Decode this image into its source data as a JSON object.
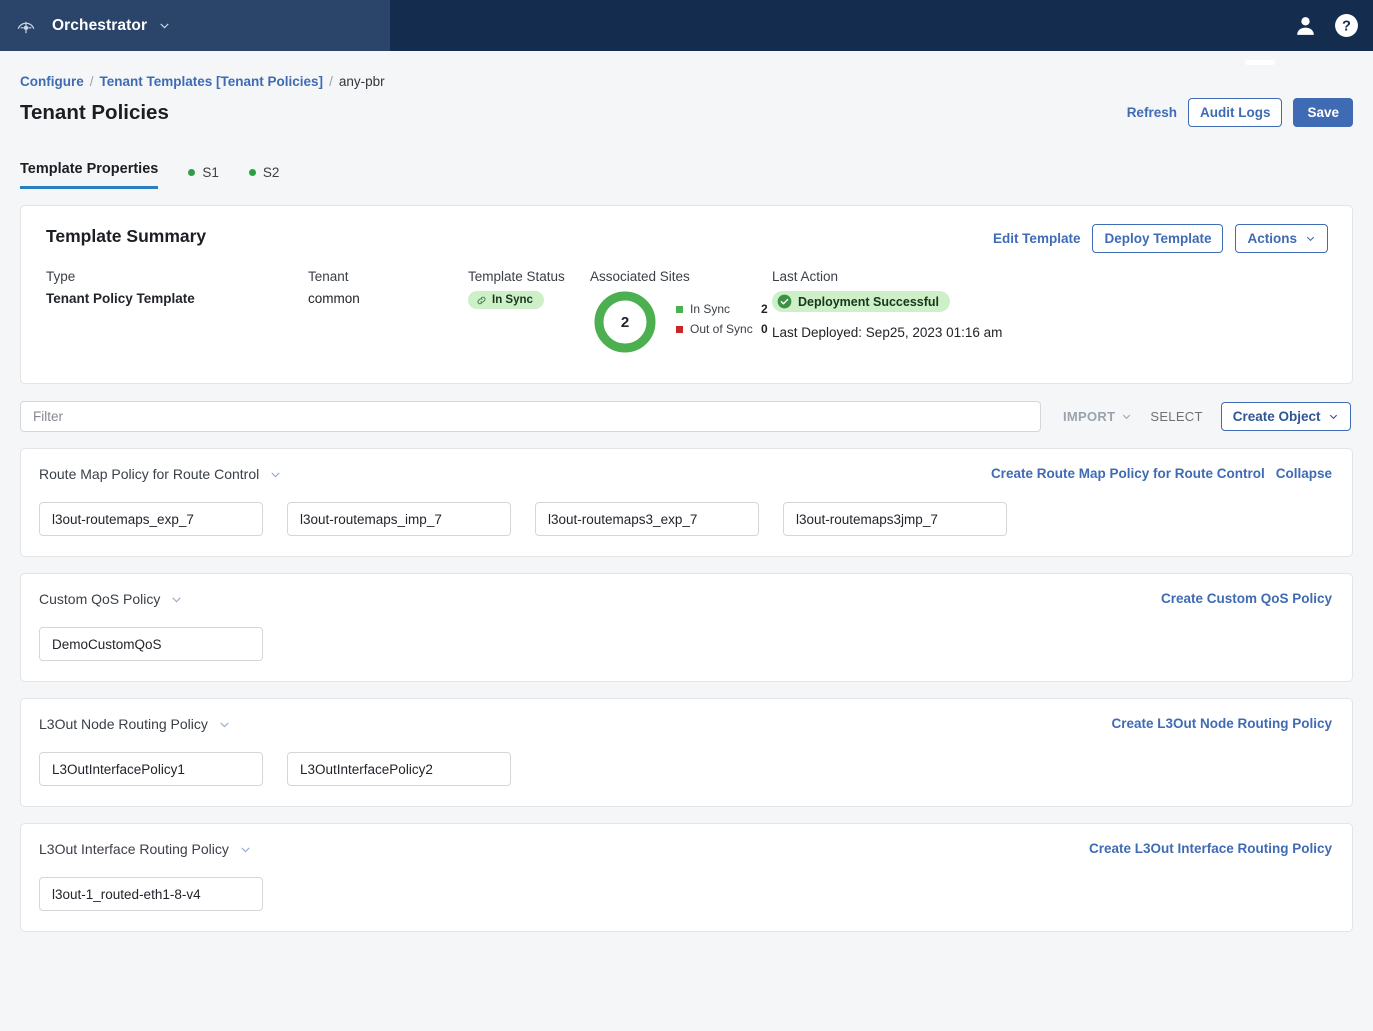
{
  "topbar": {
    "app_title": "Orchestrator",
    "logo_icon": "orchestrator-logo-icon",
    "chevron_icon": "chevron-down-icon",
    "user_icon": "user-avatar-icon",
    "help_icon": "help-circle-icon"
  },
  "breadcrumb": {
    "items": [
      {
        "label": "Configure",
        "link": true
      },
      {
        "label": "Tenant Templates [Tenant Policies]",
        "link": true
      },
      {
        "label": "any-pbr",
        "link": false
      }
    ],
    "separator": "/"
  },
  "page": {
    "title": "Tenant Policies",
    "refresh_label": "Refresh",
    "audit_logs_label": "Audit Logs",
    "save_label": "Save"
  },
  "tabs": [
    {
      "label": "Template Properties",
      "active": true,
      "dot": false
    },
    {
      "label": "S1",
      "active": false,
      "dot": true
    },
    {
      "label": "S2",
      "active": false,
      "dot": true
    }
  ],
  "summary": {
    "title": "Template Summary",
    "edit_template_label": "Edit Template",
    "deploy_template_label": "Deploy Template",
    "actions_label": "Actions",
    "type_label": "Type",
    "type_value": "Tenant Policy Template",
    "tenant_label": "Tenant",
    "tenant_value": "common",
    "status_label": "Template Status",
    "status_badge": "In Sync",
    "status_icon": "link-chain-icon",
    "sites_label": "Associated Sites",
    "sites_total": "2",
    "legend": [
      {
        "name": "In Sync",
        "value": "2",
        "color": "#4caf50"
      },
      {
        "name": "Out of Sync",
        "value": "0",
        "color": "#c62828"
      }
    ],
    "last_action_label": "Last Action",
    "last_action_badge": "Deployment Successful",
    "last_action_icon": "check-circle-icon",
    "last_deployed": "Last Deployed: Sep25, 2023 01:16 am"
  },
  "filterbar": {
    "placeholder": "Filter",
    "value": "",
    "import_label": "IMPORT",
    "select_label": "SELECT",
    "create_object_label": "Create Object",
    "chevron_icon": "chevron-down-icon"
  },
  "sections": [
    {
      "name": "Route Map Policy for Route Control",
      "links": [
        "Create Route Map Policy for Route Control",
        "Collapse"
      ],
      "items": [
        "l3out-routemaps_exp_7",
        "l3out-routemaps_imp_7",
        "l3out-routemaps3_exp_7",
        "l3out-routemaps3jmp_7"
      ]
    },
    {
      "name": "Custom QoS Policy",
      "links": [
        "Create Custom QoS Policy"
      ],
      "items": [
        "DemoCustomQoS"
      ]
    },
    {
      "name": "L3Out Node Routing Policy",
      "links": [
        "Create L3Out Node Routing Policy"
      ],
      "items": [
        "L3OutInterfacePolicy1",
        "L3OutInterfacePolicy2"
      ]
    },
    {
      "name": "L3Out Interface Routing Policy",
      "links": [
        "Create L3Out Interface Routing Policy"
      ],
      "items": [
        "l3out-1_routed-eth1-8-v4"
      ]
    }
  ],
  "colors": {
    "brand_dark": "#142c4d",
    "brand_panel": "#2b446a",
    "accent_blue": "#3f6bb5",
    "tab_underline": "#2a7fc1",
    "green": "#4caf50",
    "red": "#c62828"
  }
}
